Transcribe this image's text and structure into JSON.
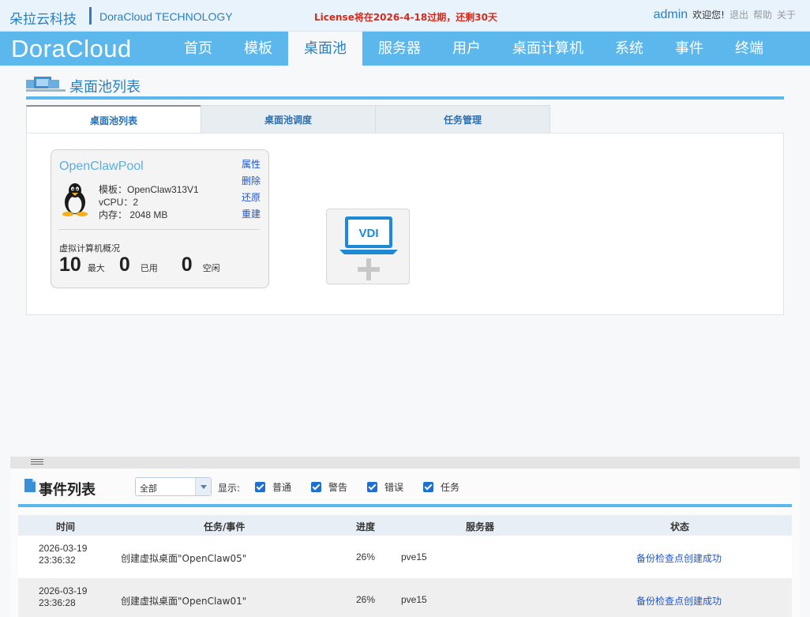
{
  "header": {
    "brand_cn": "朵拉云科技",
    "brand_en": "DoraCloud TECHNOLOGY",
    "license_notice": "License将在2026-4-18过期，还剩30天",
    "username": "admin",
    "welcome": "欢迎您!",
    "logout": "退出",
    "help": "帮助",
    "about": "关于"
  },
  "nav": {
    "logo": "DoraCloud",
    "items": [
      "首页",
      "模板",
      "桌面池",
      "服务器",
      "用户",
      "桌面计算机",
      "系统",
      "事件",
      "终端"
    ],
    "active": "桌面池"
  },
  "pool_section": {
    "title": "桌面池列表",
    "tabs": [
      "桌面池列表",
      "桌面池调度",
      "任务管理"
    ],
    "active_tab": "桌面池列表",
    "card": {
      "name": "OpenClawPool",
      "actions": [
        "属性",
        "删除",
        "还原",
        "重建"
      ],
      "os_icon": "linux-penguin-icon",
      "template_line": "模板：OpenClaw313V1",
      "vcpu_line": "vCPU：2",
      "memory_line": "内存：  2048 MB",
      "vm_summary_title": "虚拟计算机概况",
      "max_value": "10",
      "max_label": "最大",
      "used_value": "0",
      "used_label": "已用",
      "idle_value": "0",
      "idle_label": "空闲"
    },
    "add_button_text": "VDI",
    "add_button_icon": "add-vdi-laptop-icon"
  },
  "events": {
    "title": "事件列表",
    "filter_value": "全部",
    "show_label": "显示:",
    "filters": [
      {
        "label": "普通",
        "checked": true
      },
      {
        "label": "警告",
        "checked": true
      },
      {
        "label": "错误",
        "checked": true
      },
      {
        "label": "任务",
        "checked": true
      }
    ],
    "columns": {
      "time": "时间",
      "task": "任务/事件",
      "progress": "进度",
      "server": "服务器",
      "status": "状态"
    },
    "rows": [
      {
        "date": "2026-03-19",
        "time": "23:36:32",
        "task": "创建虚拟桌面\"OpenClaw05\"",
        "progress": "26%",
        "server": "pve15",
        "status": "备份检查点创建成功"
      },
      {
        "date": "2026-03-19",
        "time": "23:36:28",
        "task": "创建虚拟桌面\"OpenClaw01\"",
        "progress": "26%",
        "server": "pve15",
        "status": "备份检查点创建成功"
      }
    ]
  },
  "colors": {
    "nav_bg": "#5cb8ec",
    "accent": "#2a7fc1",
    "license_red": "#d22c1e",
    "link_blue": "#1f56c9"
  }
}
